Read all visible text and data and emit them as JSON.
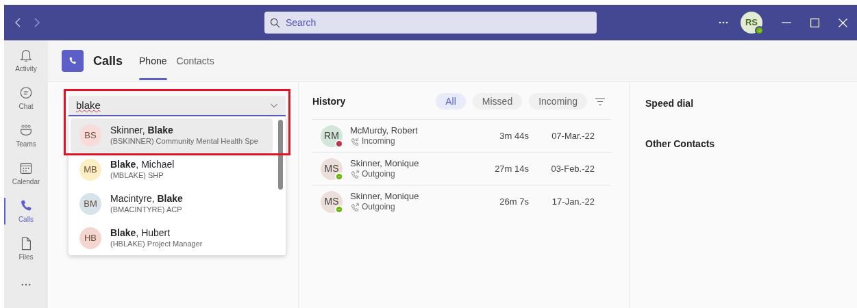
{
  "title_bar": {
    "search": {
      "placeholder": "Search"
    },
    "user": {
      "initials": "RS",
      "busy": false
    }
  },
  "rail": [
    {
      "label": "Activity",
      "selected": false
    },
    {
      "label": "Chat",
      "selected": false
    },
    {
      "label": "Teams",
      "selected": false
    },
    {
      "label": "Calendar",
      "selected": false
    },
    {
      "label": "Calls",
      "selected": true
    },
    {
      "label": "Files",
      "selected": false
    }
  ],
  "header": {
    "title": "Calls",
    "tabs": [
      {
        "label": "Phone",
        "selected": true
      },
      {
        "label": "Contacts",
        "selected": false
      }
    ]
  },
  "dial_search": {
    "value": "blake",
    "highlighted": true,
    "results": [
      {
        "initials": "BS",
        "color": "#f9dbd9",
        "name": "Skinner, **Blake**",
        "detail": "(BSKINNER) Community Mental Health Spe",
        "selected": true
      },
      {
        "initials": "MB",
        "color": "#fcefc4",
        "name": "**Blake**, Michael",
        "detail": "(MBLAKE) SHP",
        "selected": false
      },
      {
        "initials": "BM",
        "color": "#d6e4ea",
        "name": "Macintyre, **Blake**",
        "detail": "(BMACINTYRE) ACP",
        "selected": false
      },
      {
        "initials": "HB",
        "color": "#f3d6cf",
        "name": "**Blake**, Hubert",
        "detail": "(HBLAKE) Project Manager",
        "selected": false
      }
    ]
  },
  "history": {
    "title": "History",
    "filters": [
      {
        "label": "All",
        "selected": true
      },
      {
        "label": "Missed",
        "selected": false
      },
      {
        "label": "Incoming",
        "selected": false
      }
    ],
    "calls": [
      {
        "initials": "RM",
        "color": "#d3e6da",
        "busy": true,
        "name": "McMurdy, Robert",
        "kind": "incoming",
        "type": "Incoming",
        "duration": "3m 44s",
        "date": "07-Mar.-22"
      },
      {
        "initials": "MS",
        "color": "#ecdfd9",
        "busy": false,
        "name": "Skinner, Monique",
        "kind": "outgoing",
        "type": "Outgoing",
        "duration": "27m 14s",
        "date": "03-Feb.-22"
      },
      {
        "initials": "MS",
        "color": "#ecdfd9",
        "busy": false,
        "name": "Skinner, Monique",
        "kind": "outgoing",
        "type": "Outgoing",
        "duration": "26m 7s",
        "date": "17-Jan.-22"
      }
    ]
  },
  "side": {
    "sections": [
      "Speed dial",
      "Other Contacts"
    ]
  }
}
